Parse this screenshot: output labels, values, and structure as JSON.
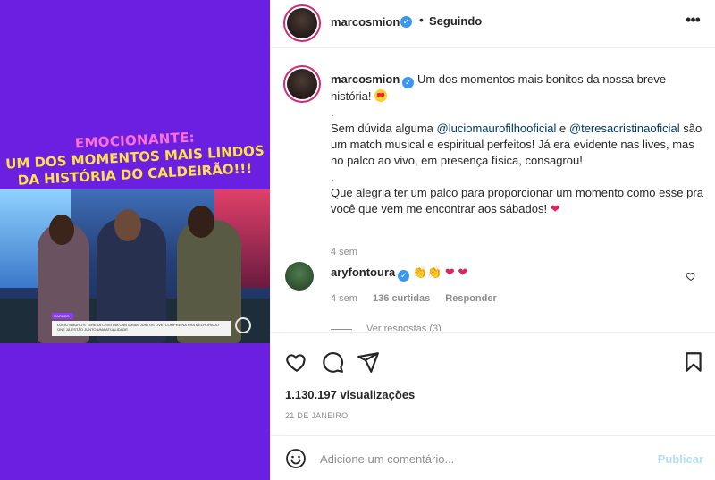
{
  "media": {
    "overlay_caption": [
      "EMOCIONANTE:",
      "UM DOS MOMENTOS MAIS LINDOS",
      "DA HISTÓRIA DO CALDEIRÃO!!!"
    ],
    "lower_third_tag": "MARCOS",
    "lower_third_text": "LÚCIO MAURO E TERESA CRISTINA CANTARAM JUNTOS LIVE. COMPRE NA PRA MELHORADO ONE JÁ ESTÃO JUNTO UMA ATUALIDADE"
  },
  "header": {
    "username": "marcosmion",
    "verified": true,
    "separator": "•",
    "follow_state": "Seguindo",
    "more_icon": "more-horizontal-icon"
  },
  "caption": {
    "username": "marcosmion",
    "line1": "Um dos momentos mais bonitos da nossa breve história!",
    "dot1": ".",
    "line2_prefix": "Sem dúvida alguma",
    "mention1": "@luciomaurofilhooficial",
    "line2_and": "e",
    "mention2": "@teresacristinaoficial",
    "line2_suffix": "são um match musical e espiritual perfeitos! Já era evidente nas lives, mas no palco ao vivo, em presença física, consagrou!",
    "dot2": ".",
    "line3": "Que alegria ter um palco para proporcionar um momento como esse pra você que vem me encontrar aos sábados!",
    "time": "4 sem"
  },
  "comment": {
    "username": "aryfontoura",
    "verified": true,
    "emojis": [
      "clapping-hands",
      "clapping-hands",
      "red-heart",
      "red-heart"
    ],
    "time": "4 sem",
    "likes": "136 curtidas",
    "reply": "Responder",
    "view_replies": "Ver respostas (3)"
  },
  "actions": {
    "icons": [
      "heart-icon",
      "comment-icon",
      "share-icon",
      "bookmark-icon"
    ],
    "views": "1.130.197 visualizações",
    "date": "21 DE JANEIRO"
  },
  "composer": {
    "placeholder": "Adicione um comentário...",
    "publish": "Publicar"
  },
  "colors": {
    "media_bg": "#6b1fe0",
    "verified": "#3897f0",
    "mention": "#00376b",
    "publish_disabled": "#b2dffc"
  }
}
